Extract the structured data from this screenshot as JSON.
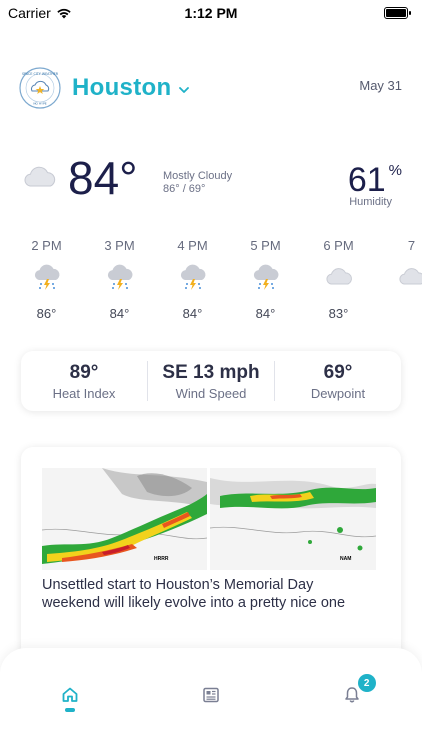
{
  "status_bar": {
    "carrier": "Carrier",
    "time": "1:12 PM"
  },
  "header": {
    "logo_text": "SPACE CITY WEATHER · NO HYPE",
    "city": "Houston",
    "date": "May 31"
  },
  "current": {
    "icon": "cloudy-icon",
    "temperature": "84°",
    "condition": "Mostly Cloudy",
    "high_low": "86° / 69°",
    "humidity_value": "61",
    "humidity_unit": "%",
    "humidity_label": "Humidity"
  },
  "hourly": [
    {
      "time": "2 PM",
      "icon": "thunderstorm-icon",
      "temp": "86°"
    },
    {
      "time": "3 PM",
      "icon": "thunderstorm-icon",
      "temp": "84°"
    },
    {
      "time": "4 PM",
      "icon": "thunderstorm-icon",
      "temp": "84°"
    },
    {
      "time": "5 PM",
      "icon": "thunderstorm-icon",
      "temp": "84°"
    },
    {
      "time": "6 PM",
      "icon": "cloudy-icon",
      "temp": "83°"
    },
    {
      "time": "7",
      "icon": "cloudy-icon",
      "temp": ""
    }
  ],
  "stats": [
    {
      "value": "89°",
      "label": "Heat Index"
    },
    {
      "value": "SE 13 mph",
      "label": "Wind Speed"
    },
    {
      "value": "69°",
      "label": "Dewpoint"
    }
  ],
  "article": {
    "map_labels": [
      "HRRR",
      "NAM"
    ],
    "title": "Unsettled start to Houston’s Memorial Day weekend will likely evolve into a pretty nice one"
  },
  "tabbar": {
    "notifications_badge": "2"
  },
  "colors": {
    "accent": "#1fb2c8",
    "text_dark": "#1c1f4a",
    "text_muted": "#6b7086"
  }
}
